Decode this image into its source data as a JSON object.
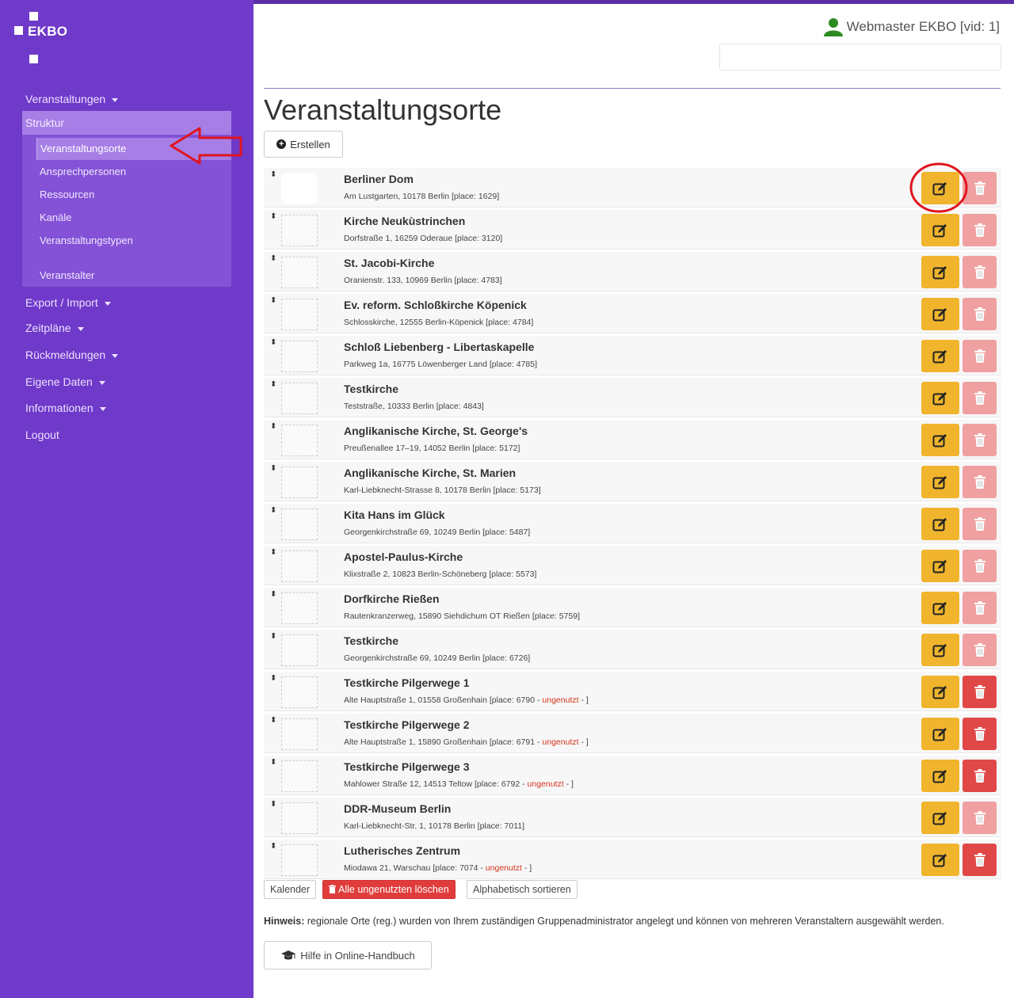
{
  "brand": {
    "name": "EKBO"
  },
  "sidebar": {
    "items": [
      {
        "label": "Veranstaltungen"
      },
      {
        "label": "Struktur"
      },
      {
        "label": "Export / Import"
      },
      {
        "label": "Zeitpläne"
      },
      {
        "label": "Rückmeldungen"
      },
      {
        "label": "Eigene Daten"
      },
      {
        "label": "Informationen"
      },
      {
        "label": "Logout"
      }
    ],
    "struktur_sub": [
      {
        "label": "Veranstaltungsorte"
      },
      {
        "label": "Ansprechpersonen"
      },
      {
        "label": "Ressourcen"
      },
      {
        "label": "Kanäle"
      },
      {
        "label": "Veranstaltungstypen"
      },
      {
        "label": "Veranstalter"
      }
    ]
  },
  "user": {
    "name": "Webmaster EKBO [vid: 1]"
  },
  "page": {
    "title": "Veranstaltungsorte",
    "create_label": "Erstellen"
  },
  "places": [
    {
      "name": "Berliner Dom",
      "address": "Am Lustgarten, 10178 Berlin [place: 1629]"
    },
    {
      "name": "Kirche Neukùstrinchen",
      "address": "Dorfstraße 1, 16259 Oderaue [place: 3120]"
    },
    {
      "name": "St. Jacobi-Kirche",
      "address": "Oranienstr. 133, 10969 Berlin [place: 4783]"
    },
    {
      "name": "Ev. reform. Schloßkirche Köpenick",
      "address": "Schlosskirche, 12555 Berlin-Köpenick [place: 4784]"
    },
    {
      "name": "Schloß Liebenberg - Libertaskapelle",
      "address": "Parkweg 1a, 16775 Löwenberger Land [place: 4785]"
    },
    {
      "name": "Testkirche",
      "address": "Teststraße, 10333 Berlin [place: 4843]"
    },
    {
      "name": "Anglikanische Kirche, St. George's",
      "address": "Preußenallee 17–19, 14052 Berlin [place: 5172]"
    },
    {
      "name": "Anglikanische Kirche, St. Marien",
      "address": "Karl-Liebknecht-Strasse 8, 10178 Berlin [place: 5173]"
    },
    {
      "name": "Kita Hans im Glück",
      "address": "Georgenkirchstraße 69, 10249 Berlin [place: 5487]"
    },
    {
      "name": "Apostel-Paulus-Kirche",
      "address": "Klixstraße 2, 10823 Berlin-Schöneberg [place: 5573]"
    },
    {
      "name": "Dorfkirche Rießen",
      "address": "Rautenkranzerweg, 15890 Siehdichum OT Rießen [place: 5759]"
    },
    {
      "name": "Testkirche",
      "address": "Georgenkirchstraße 69, 10249 Berlin [place: 6726]"
    },
    {
      "name": "Testkirche Pilgerwege 1",
      "address": "Alte Hauptstraße 1, 01558 Großenhain [place: 6790 - ",
      "unused": "ungenutzt",
      "suffix": " - ]"
    },
    {
      "name": "Testkirche Pilgerwege 2",
      "address": "Alte Hauptstraße 1, 15890 Großenhain [place: 6791 - ",
      "unused": "ungenutzt",
      "suffix": " - ]"
    },
    {
      "name": "Testkirche Pilgerwege 3",
      "address": "Mahlower Straße 12, 14513 Teltow [place: 6792 - ",
      "unused": "ungenutzt",
      "suffix": " - ]"
    },
    {
      "name": "DDR-Museum Berlin",
      "address": "Karl-Liebknecht-Str. 1, 10178 Berlin [place: 7011]"
    },
    {
      "name": "Lutherisches Zentrum",
      "address": "Miodawa 21, Warschau [place: 7074 - ",
      "unused": "ungenutzt",
      "suffix": " - ]"
    }
  ],
  "footer": {
    "calendar_label": "Kalender",
    "delete_unused_label": "Alle ungenutzten löschen",
    "sort_label": "Alphabetisch sortieren",
    "hint_label": "Hinweis:",
    "hint_text": " regionale Orte (reg.) wurden von Ihrem zuständigen Gruppenadministrator angelegt und können von mehreren Veranstaltern ausgewählt werden.",
    "help_label": "Hilfe in Online-Handbuch"
  },
  "colors": {
    "sidebar": "#6f39c9",
    "edit": "#f0b52d",
    "delete_disabled": "#f0a0a0",
    "delete_active": "#e04848",
    "highlight": "#e0141e"
  },
  "icons": [
    "drag-handle-icon",
    "edit-icon",
    "trash-icon",
    "plus-circle-icon",
    "graduation-cap-icon",
    "user-icon",
    "arrow-icon"
  ]
}
